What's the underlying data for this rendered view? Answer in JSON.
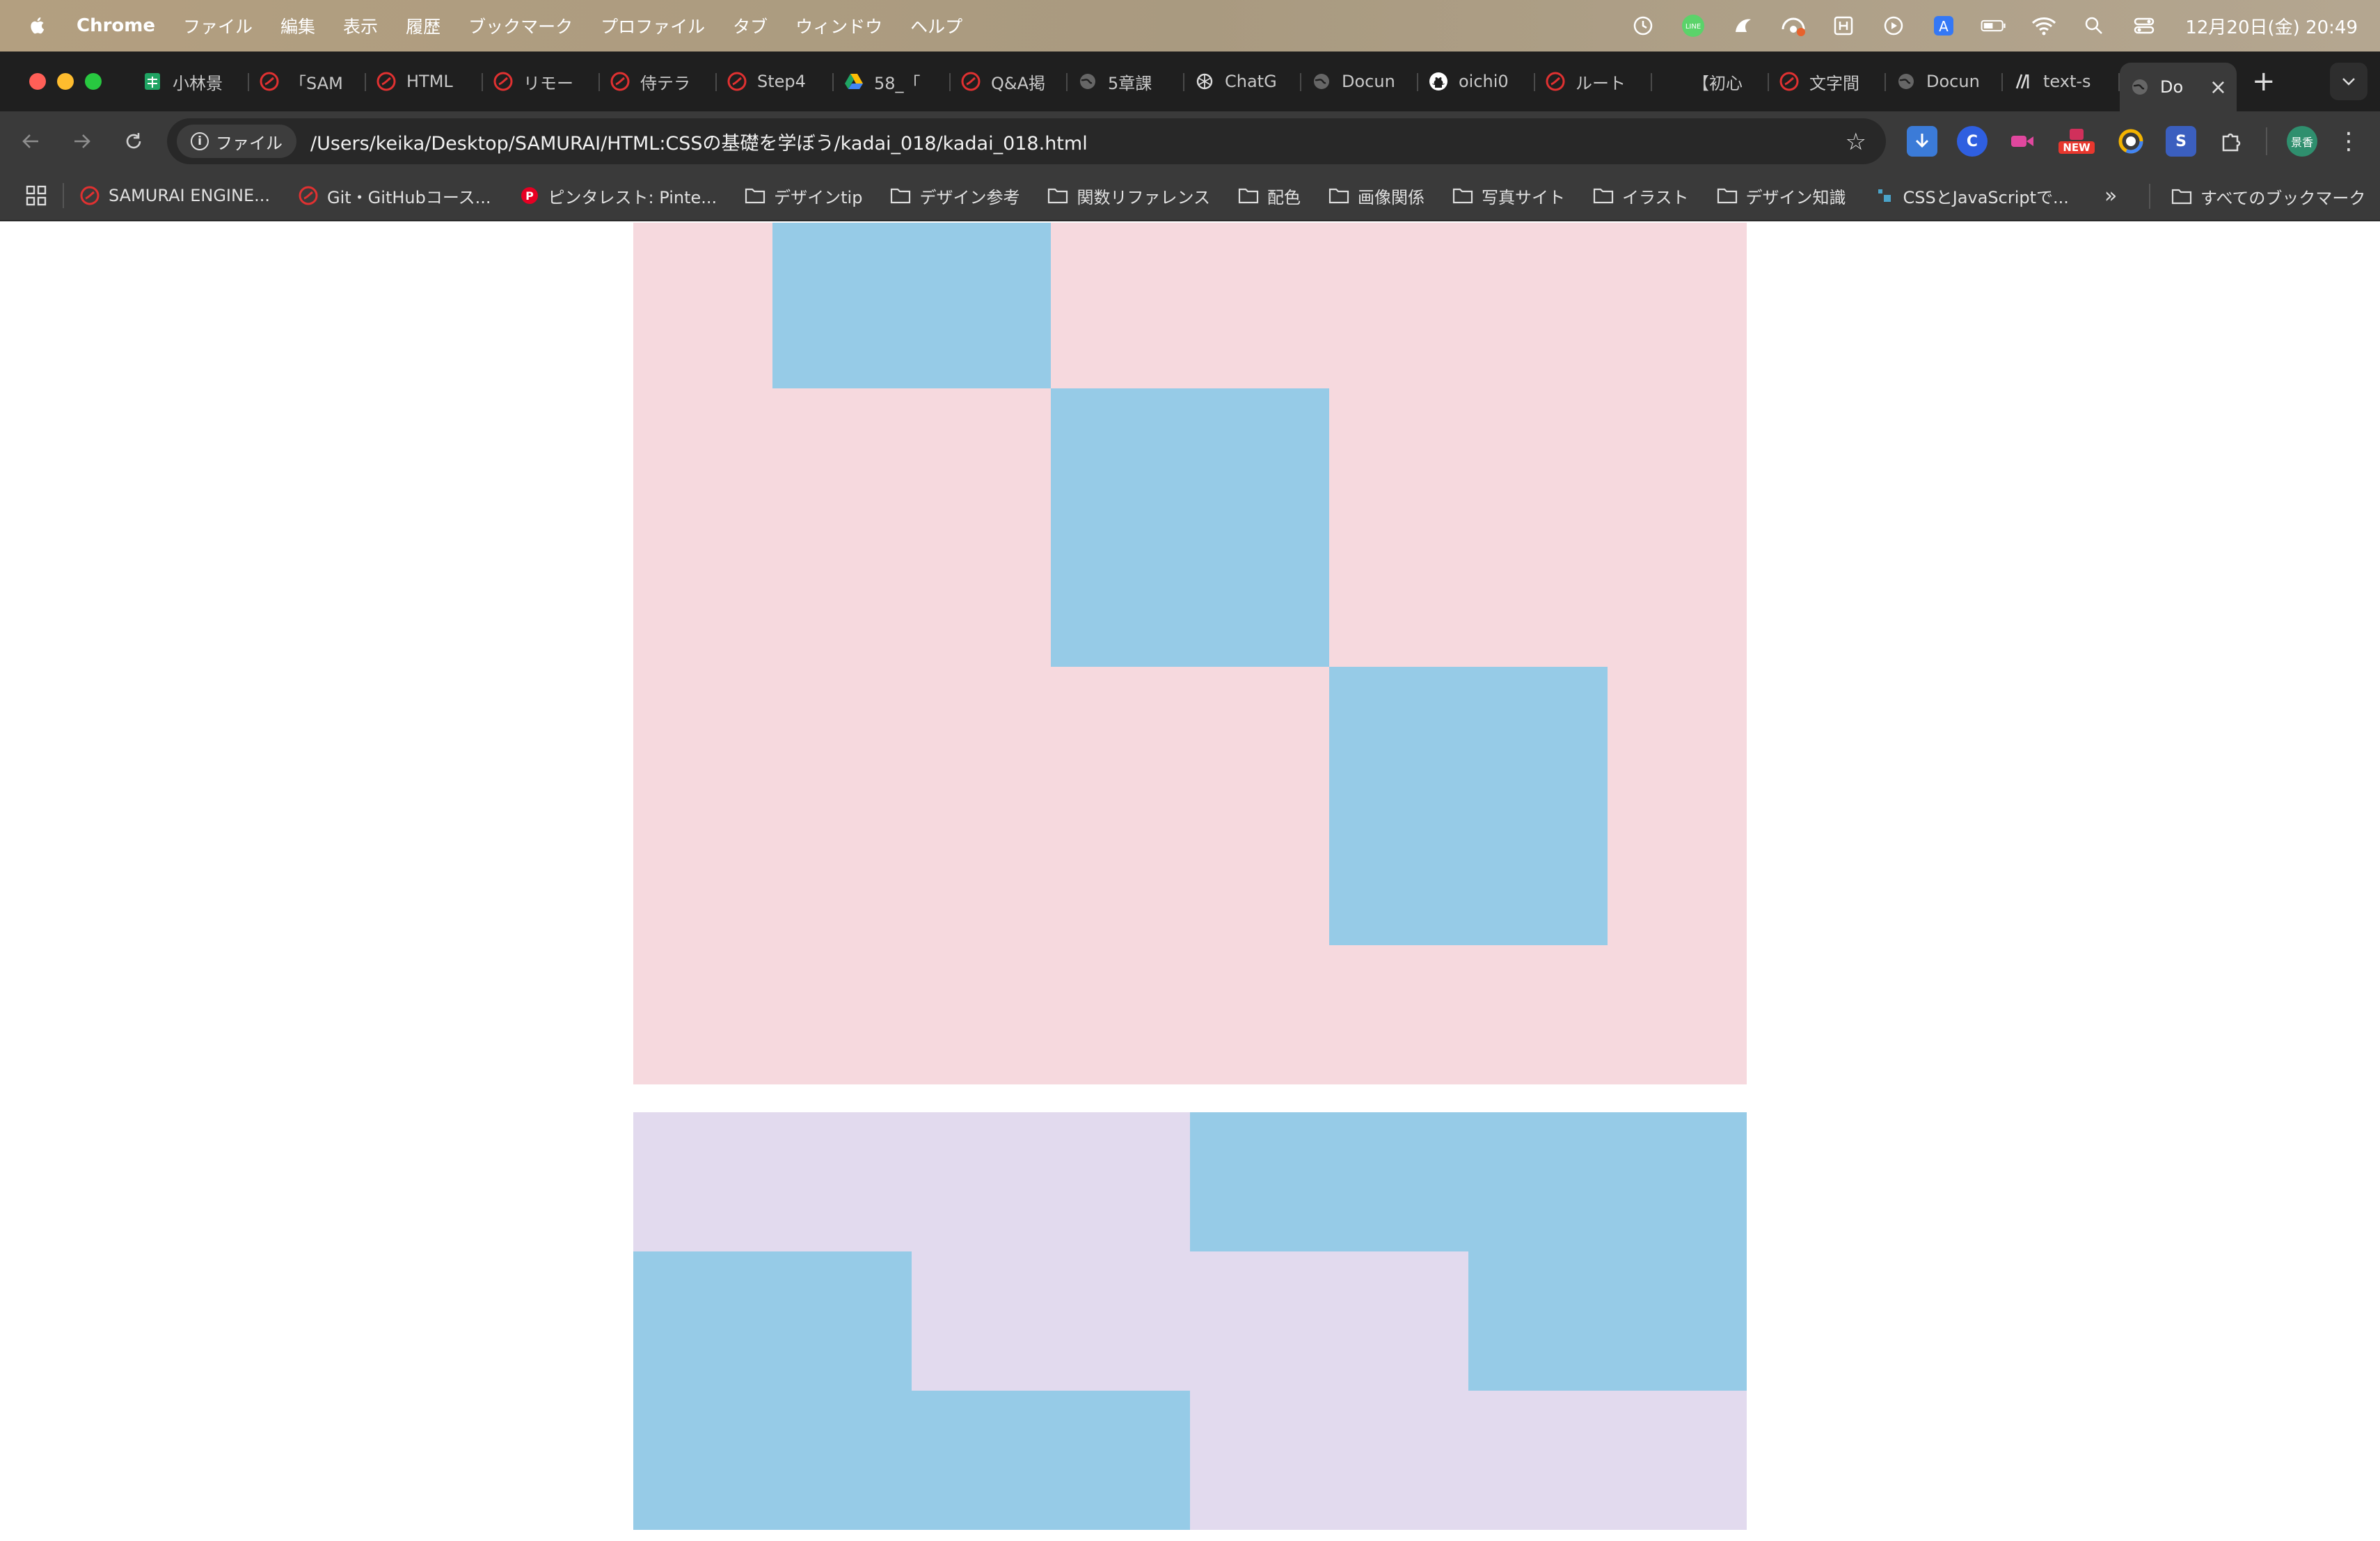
{
  "menubar": {
    "app": "Chrome",
    "menus": [
      "ファイル",
      "編集",
      "表示",
      "履歴",
      "ブックマーク",
      "プロファイル",
      "タブ",
      "ウィンドウ",
      "ヘルプ"
    ],
    "clock": "12月20日(金) 20:49",
    "status_icons": [
      "time-machine-icon",
      "line-icon",
      "app-icon",
      "vpn-icon",
      "input-icon",
      "media-icon",
      "text-input-icon",
      "battery-icon",
      "wifi-icon",
      "spotlight-icon",
      "control-center-icon"
    ]
  },
  "tabs": [
    {
      "title": "小林景",
      "favicon": "sheets-icon"
    },
    {
      "title": "「SAM",
      "favicon": "samurai-icon"
    },
    {
      "title": "HTML",
      "favicon": "samurai-icon"
    },
    {
      "title": "リモー",
      "favicon": "samurai-icon"
    },
    {
      "title": "侍テラ",
      "favicon": "samurai-icon"
    },
    {
      "title": "Step4",
      "favicon": "samurai-icon"
    },
    {
      "title": "58_「",
      "favicon": "drive-icon"
    },
    {
      "title": "Q&A掲",
      "favicon": "samurai-icon"
    },
    {
      "title": "5章課",
      "favicon": "globe-icon"
    },
    {
      "title": "ChatG",
      "favicon": "chatgpt-icon"
    },
    {
      "title": "Docun",
      "favicon": "globe-icon"
    },
    {
      "title": "oichi0",
      "favicon": "github-icon"
    },
    {
      "title": "ルート",
      "favicon": "samurai-icon"
    },
    {
      "title": "【初心",
      "favicon": "blank-icon"
    },
    {
      "title": "文字間",
      "favicon": "samurai-icon"
    },
    {
      "title": "Docun",
      "favicon": "globe-icon"
    },
    {
      "title": "text-s",
      "favicon": "mdn-icon"
    },
    {
      "title": "Do",
      "favicon": "globe-icon",
      "active": true
    }
  ],
  "toolbar": {
    "site_chip": "ファイル",
    "url": "/Users/keika/Desktop/SAMURAI/HTML:CSSの基礎を学ぼう/kadai_018/kadai_018.html",
    "new_badge": "NEW",
    "avatar_text": "景香"
  },
  "bookmarks": [
    {
      "label": "SAMURAI ENGINE...",
      "icon": "samurai-icon"
    },
    {
      "label": "Git・GitHubコース...",
      "icon": "samurai-icon"
    },
    {
      "label": "ピンタレスト: Pinte...",
      "icon": "pinterest-icon"
    },
    {
      "label": "デザインtip",
      "icon": "folder-icon"
    },
    {
      "label": "デザイン参考",
      "icon": "folder-icon"
    },
    {
      "label": "関数リファレンス",
      "icon": "folder-icon"
    },
    {
      "label": "配色",
      "icon": "folder-icon"
    },
    {
      "label": "画像関係",
      "icon": "folder-icon"
    },
    {
      "label": "写真サイト",
      "icon": "folder-icon"
    },
    {
      "label": "イラスト",
      "icon": "folder-icon"
    },
    {
      "label": "デザイン知識",
      "icon": "folder-icon"
    },
    {
      "label": "CSSとJavaScriptで...",
      "icon": "site-icon"
    }
  ],
  "all_bookmarks": "すべてのブックマーク",
  "colors": {
    "pink_panel": "#f6d9de",
    "lavender_panel": "#e2daee",
    "blue_square": "#96cbe7"
  }
}
